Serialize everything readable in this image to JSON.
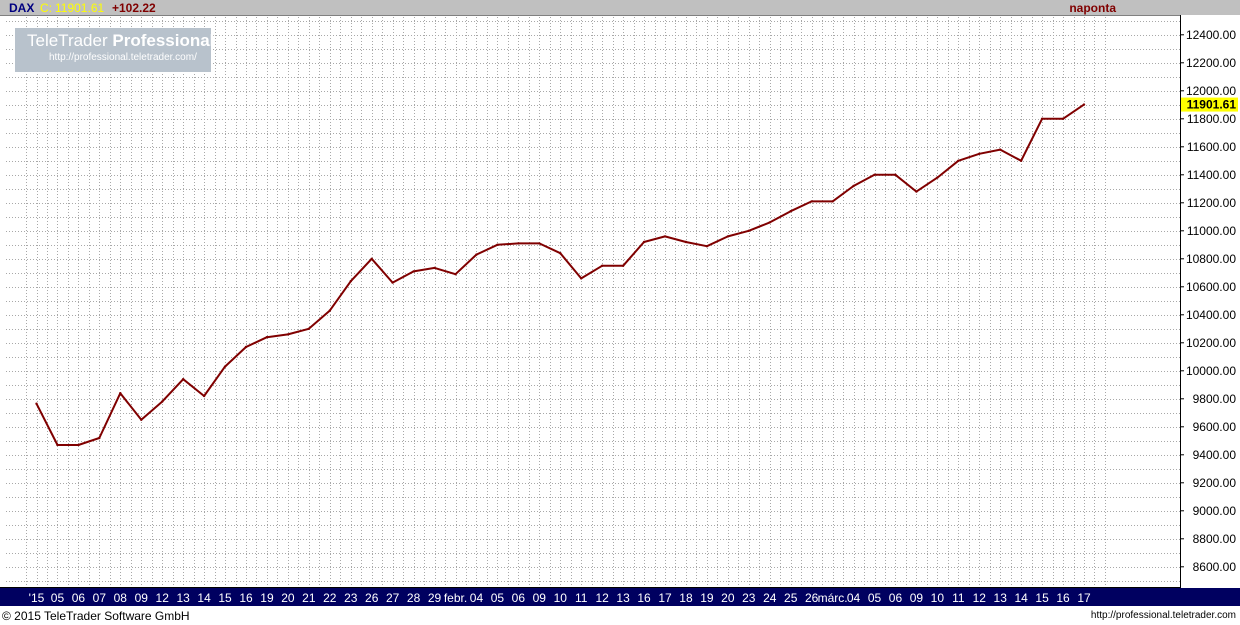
{
  "header": {
    "symbol": "DAX",
    "close_prefix": "C:",
    "close_value": "11901.61",
    "change": "+102.22",
    "interval": "naponta"
  },
  "logo": {
    "title_regular": "TeleTrader",
    "title_bold": "Professional",
    "url": "http://professional.teletrader.com/"
  },
  "footer": {
    "copyright": "© 2015 TeleTrader Software GmbH",
    "url": "http://professional.teletrader.com"
  },
  "colors": {
    "line": "#800000",
    "grid": "#a8a8a8",
    "axis_bar": "#000060",
    "last_value_bg": "#ffff00"
  },
  "chart_data": {
    "type": "line",
    "title": "",
    "ylim": [
      8450,
      12600
    ],
    "y_ticks": [
      8600,
      8800,
      9000,
      9200,
      9400,
      9600,
      9800,
      10000,
      10200,
      10400,
      10600,
      10800,
      11000,
      11200,
      11400,
      11600,
      11800,
      12000,
      12200,
      12400
    ],
    "y_tick_labels": [
      "8600.00",
      "8800.00",
      "9000.00",
      "9200.00",
      "9400.00",
      "9600.00",
      "9800.00",
      "10000.00",
      "10200.00",
      "10400.00",
      "10600.00",
      "10800.00",
      "11000.00",
      "11200.00",
      "11400.00",
      "11600.00",
      "11800.00",
      "12000.00",
      "12200.00",
      "12400.00"
    ],
    "last_value_label": "11901.61",
    "x_labels": [
      "'15",
      "05",
      "06",
      "07",
      "08",
      "09",
      "12",
      "13",
      "14",
      "15",
      "16",
      "19",
      "20",
      "21",
      "22",
      "23",
      "26",
      "27",
      "28",
      "29",
      "febr.",
      "04",
      "05",
      "06",
      "09",
      "10",
      "11",
      "12",
      "13",
      "16",
      "17",
      "18",
      "19",
      "20",
      "23",
      "24",
      "25",
      "26",
      "márc.",
      "04",
      "05",
      "06",
      "09",
      "10",
      "11",
      "12",
      "13",
      "14",
      "15",
      "16",
      "17"
    ],
    "series": [
      {
        "values": [
          9765,
          9470,
          9470,
          9520,
          9840,
          9650,
          9780,
          9940,
          9820,
          10030,
          10170,
          10240,
          10260,
          10300,
          10430,
          10640,
          10800,
          10630,
          10710,
          10735,
          10690,
          10830,
          10900,
          10910,
          10910,
          10840,
          10660,
          10750,
          10750,
          10920,
          10960,
          10920,
          10890,
          10960,
          11000,
          11060,
          11140,
          11210,
          11210,
          11320,
          11400,
          11400,
          11280,
          11380,
          11500,
          11550,
          11580,
          11500,
          11800,
          11800,
          11901.61
        ]
      }
    ]
  }
}
